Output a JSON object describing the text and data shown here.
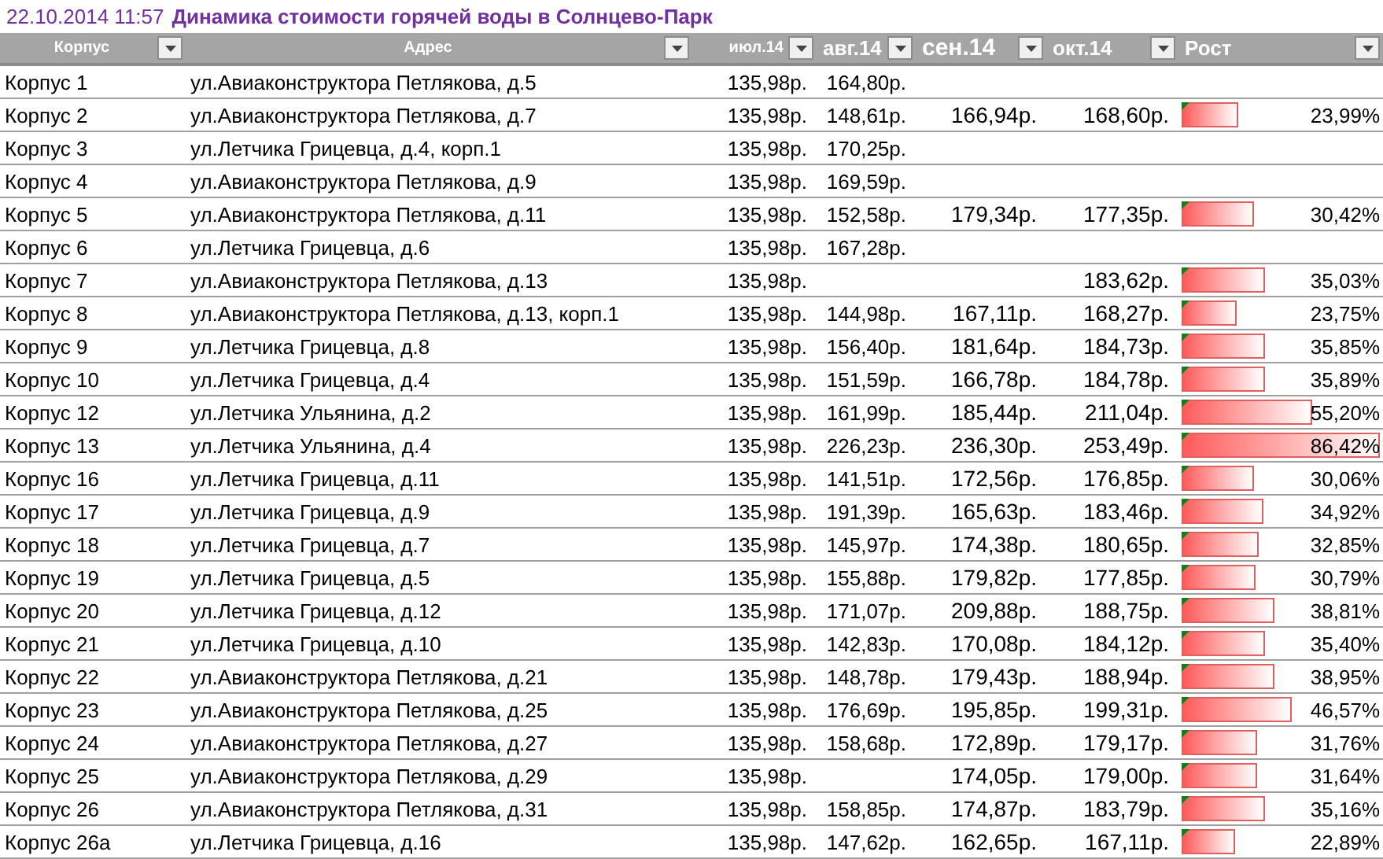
{
  "title": {
    "timestamp": "22.10.2014 11:57",
    "text": "Динамика стоимости горячей воды в Солнцево-Парк"
  },
  "columns": [
    {
      "label": "Корпус",
      "kind": "small"
    },
    {
      "label": "Адрес",
      "kind": "small"
    },
    {
      "label": "июл.14",
      "kind": "small"
    },
    {
      "label": "авг.14",
      "kind": "medium"
    },
    {
      "label": "сен.14",
      "kind": "large"
    },
    {
      "label": "окт.14",
      "kind": "medium"
    },
    {
      "label": "Рост",
      "kind": "medium"
    }
  ],
  "rows": [
    {
      "building": "Корпус 1",
      "address": "ул.Авиаконструктора Петлякова, д.5",
      "jul": "135,98р.",
      "aug": "164,80р."
    },
    {
      "building": "Корпус 2",
      "address": "ул.Авиаконструктора Петлякова, д.7",
      "jul": "135,98р.",
      "aug": "148,61р.",
      "sep": "166,94р.",
      "oct": "168,60р.",
      "growth": {
        "level": 0.28,
        "text": "23,99%",
        "flag": true
      }
    },
    {
      "building": "Корпус 3",
      "address": "ул.Летчика Грицевца, д.4, корп.1",
      "jul": "135,98р.",
      "aug": "170,25р."
    },
    {
      "building": "Корпус 4",
      "address": "ул.Авиаконструктора Петлякова, д.9",
      "jul": "135,98р.",
      "aug": "169,59р."
    },
    {
      "building": "Корпус 5",
      "address": "ул.Авиаконструктора Петлякова, д.11",
      "jul": "135,98р.",
      "aug": "152,58р.",
      "sep": "179,34р.",
      "oct": "177,35р.",
      "growth": {
        "level": 0.35,
        "text": "30,42%",
        "flag": true
      }
    },
    {
      "building": "Корпус 6",
      "address": "ул.Летчика Грицевца, д.6",
      "jul": "135,98р.",
      "aug": "167,28р."
    },
    {
      "building": "Корпус 7",
      "address": "ул.Авиаконструктора Петлякова, д.13",
      "jul": "135,98р.",
      "oct": "183,62р.",
      "growth": {
        "level": 0.41,
        "text": "35,03%",
        "flag": true
      }
    },
    {
      "building": "Корпус 8",
      "address": "ул.Авиаконструктора Петлякова, д.13, корп.1",
      "jul": "135,98р.",
      "aug": "144,98р.",
      "sep": "167,11р.",
      "oct": "168,27р.",
      "growth": {
        "level": 0.27,
        "text": "23,75%",
        "flag": true
      }
    },
    {
      "building": "Корпус 9",
      "address": "ул.Летчика Грицевца, д.8",
      "jul": "135,98р.",
      "aug": "156,40р.",
      "sep": "181,64р.",
      "oct": "184,73р.",
      "growth": {
        "level": 0.41,
        "text": "35,85%",
        "flag": true
      }
    },
    {
      "building": "Корпус 10",
      "address": "ул.Летчика Грицевца, д.4",
      "jul": "135,98р.",
      "aug": "151,59р.",
      "sep": "166,78р.",
      "oct": "184,78р.",
      "growth": {
        "level": 0.41,
        "text": "35,89%",
        "flag": true
      }
    },
    {
      "building": "Корпус 12",
      "address": "ул.Летчика Ульянина, д.2",
      "jul": "135,98р.",
      "aug": "161,99р.",
      "sep": "185,44р.",
      "oct": "211,04р.",
      "growth": {
        "level": 0.64,
        "text": "55,20%",
        "flag": true
      }
    },
    {
      "building": "Корпус 13",
      "address": "ул.Летчика Ульянина, д.4",
      "jul": "135,98р.",
      "aug": "226,23р.",
      "sep": "236,30р.",
      "oct": "253,49р.",
      "growth": {
        "level": 1,
        "text": "86,42%",
        "flag": true
      }
    },
    {
      "building": "Корпус 16",
      "address": "ул.Летчика Грицевца, д.11",
      "jul": "135,98р.",
      "aug": "141,51р.",
      "sep": "172,56р.",
      "oct": "176,85р.",
      "growth": {
        "level": 0.35,
        "text": "30,06%",
        "flag": true
      }
    },
    {
      "building": "Корпус 17",
      "address": "ул.Летчика Грицевца, д.9",
      "jul": "135,98р.",
      "aug": "191,39р.",
      "sep": "165,63р.",
      "oct": "183,46р.",
      "growth": {
        "level": 0.4,
        "text": "34,92%",
        "flag": true
      }
    },
    {
      "building": "Корпус 18",
      "address": "ул.Летчика Грицевца, д.7",
      "jul": "135,98р.",
      "aug": "145,97р.",
      "sep": "174,38р.",
      "oct": "180,65р.",
      "growth": {
        "level": 0.38,
        "text": "32,85%",
        "flag": true
      }
    },
    {
      "building": "Корпус 19",
      "address": "ул.Летчика Грицевца, д.5",
      "jul": "135,98р.",
      "aug": "155,88р.",
      "sep": "179,82р.",
      "oct": "177,85р.",
      "growth": {
        "level": 0.36,
        "text": "30,79%",
        "flag": true
      }
    },
    {
      "building": "Корпус 20",
      "address": "ул.Летчика Грицевца, д.12",
      "jul": "135,98р.",
      "aug": "171,07р.",
      "sep": "209,88р.",
      "oct": "188,75р.",
      "growth": {
        "level": 0.45,
        "text": "38,81%",
        "flag": true
      }
    },
    {
      "building": "Корпус 21",
      "address": "ул.Летчика Грицевца, д.10",
      "jul": "135,98р.",
      "aug": "142,83р.",
      "sep": "170,08р.",
      "oct": "184,12р.",
      "growth": {
        "level": 0.41,
        "text": "35,40%",
        "flag": true
      }
    },
    {
      "building": "Корпус 22",
      "address": "ул.Авиаконструктора Петлякова, д.21",
      "jul": "135,98р.",
      "aug": "148,78р.",
      "sep": "179,43р.",
      "oct": "188,94р.",
      "growth": {
        "level": 0.45,
        "text": "38,95%",
        "flag": true
      }
    },
    {
      "building": "Корпус 23",
      "address": "ул.Авиаконструктора Петлякова, д.25",
      "jul": "135,98р.",
      "aug": "176,69р.",
      "sep": "195,85р.",
      "oct": "199,31р.",
      "growth": {
        "level": 0.54,
        "text": "46,57%",
        "flag": true
      }
    },
    {
      "building": "Корпус 24",
      "address": "ул.Авиаконструктора Петлякова, д.27",
      "jul": "135,98р.",
      "aug": "158,68р.",
      "sep": "172,89р.",
      "oct": "179,17р.",
      "growth": {
        "level": 0.37,
        "text": "31,76%",
        "flag": true
      }
    },
    {
      "building": "Корпус 25",
      "address": "ул.Авиаконструктора Петлякова, д.29",
      "jul": "135,98р.",
      "sep": "174,05р.",
      "oct": "179,00р.",
      "growth": {
        "level": 0.37,
        "text": "31,64%",
        "flag": true
      }
    },
    {
      "building": "Корпус 26",
      "address": "ул.Авиаконструктора Петлякова, д.31",
      "jul": "135,98р.",
      "aug": "158,85р.",
      "sep": "174,87р.",
      "oct": "183,79р.",
      "growth": {
        "level": 0.41,
        "text": "35,16%",
        "flag": true
      }
    },
    {
      "building": "Корпус 26а",
      "address": "ул.Летчика Грицевца, д.16",
      "jul": "135,98р.",
      "aug": "147,62р.",
      "sep": "162,65р.",
      "oct": "167,11р.",
      "growth": {
        "level": 0.26,
        "text": "22,89%",
        "flag": true
      }
    }
  ]
}
